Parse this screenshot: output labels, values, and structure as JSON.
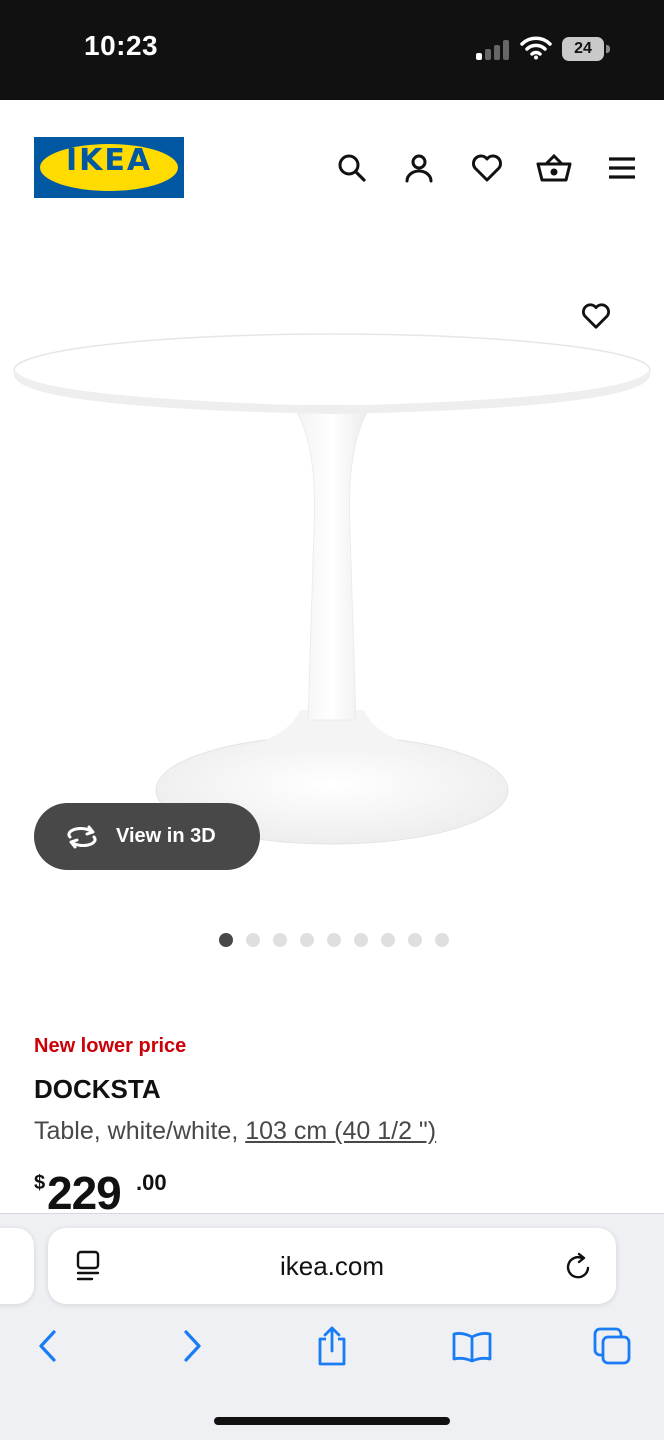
{
  "status_bar": {
    "time": "10:23",
    "battery": "24"
  },
  "header": {
    "logo_text": "IKEA",
    "icons": [
      "search-icon",
      "account-icon",
      "favorites-icon",
      "basket-icon",
      "menu-icon"
    ]
  },
  "gallery": {
    "view_3d_label": "View in 3D",
    "dot_count": 9,
    "active_dot": 1
  },
  "product": {
    "price_tag": "New lower price",
    "name": "DOCKSTA",
    "description": "Table, white/white, ",
    "size": "103 cm (40 1/2 \")",
    "price_currency": "$",
    "price_integer": "229",
    "price_decimal": ".00"
  },
  "browser": {
    "url": "ikea.com",
    "toolbar": [
      "back-icon",
      "forward-icon",
      "share-icon",
      "bookmarks-icon",
      "tabs-icon"
    ]
  },
  "colors": {
    "ikea_blue": "#0058a3",
    "ikea_yellow": "#ffdb00",
    "price_red": "#cc0008",
    "safari_blue": "#1a7cf5"
  }
}
